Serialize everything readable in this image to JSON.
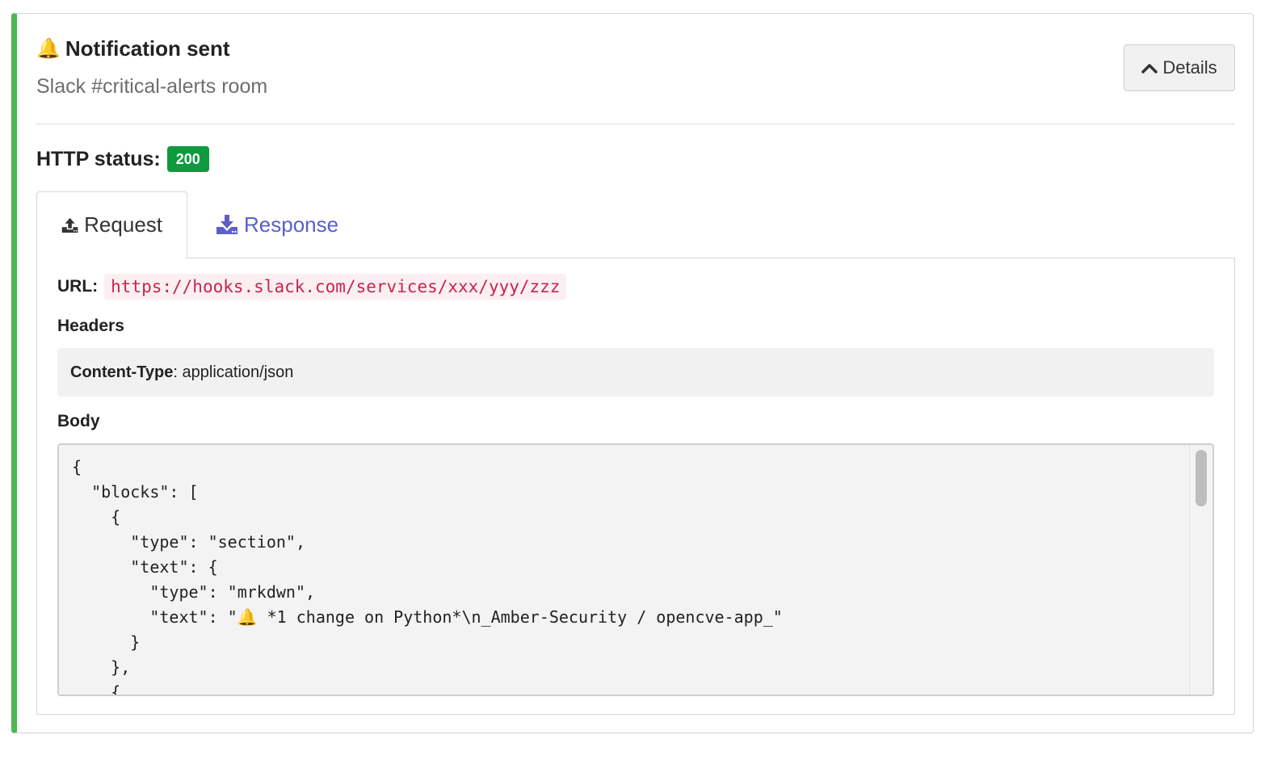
{
  "header": {
    "icon": "bell-icon",
    "title": "Notification sent",
    "subtitle": "Slack #critical-alerts room",
    "details_button": "Details"
  },
  "status": {
    "label": "HTTP status:",
    "code": "200",
    "badge_color": "#109a3e"
  },
  "tabs": [
    {
      "label": "Request",
      "icon": "upload-icon",
      "active": true
    },
    {
      "label": "Response",
      "icon": "download-icon",
      "active": false
    }
  ],
  "request": {
    "url_label": "URL:",
    "url": "https://hooks.slack.com/services/xxx/yyy/zzz",
    "headers_label": "Headers",
    "headers": [
      {
        "name": "Content-Type",
        "value": ": application/json"
      }
    ],
    "body_label": "Body",
    "body_lines": [
      "{",
      "  \"blocks\": [",
      "    {",
      "      \"type\": \"section\",",
      "      \"text\": {",
      "        \"type\": \"mrkdwn\",",
      "        \"text\": \"🔔 *1 change on Python*\\n_Amber-Security / opencve-app_\"",
      "      }",
      "    },",
      "    {"
    ]
  },
  "colors": {
    "accent_border": "#4cb851",
    "link": "#5b5fc7",
    "url_text": "#c7254e"
  }
}
